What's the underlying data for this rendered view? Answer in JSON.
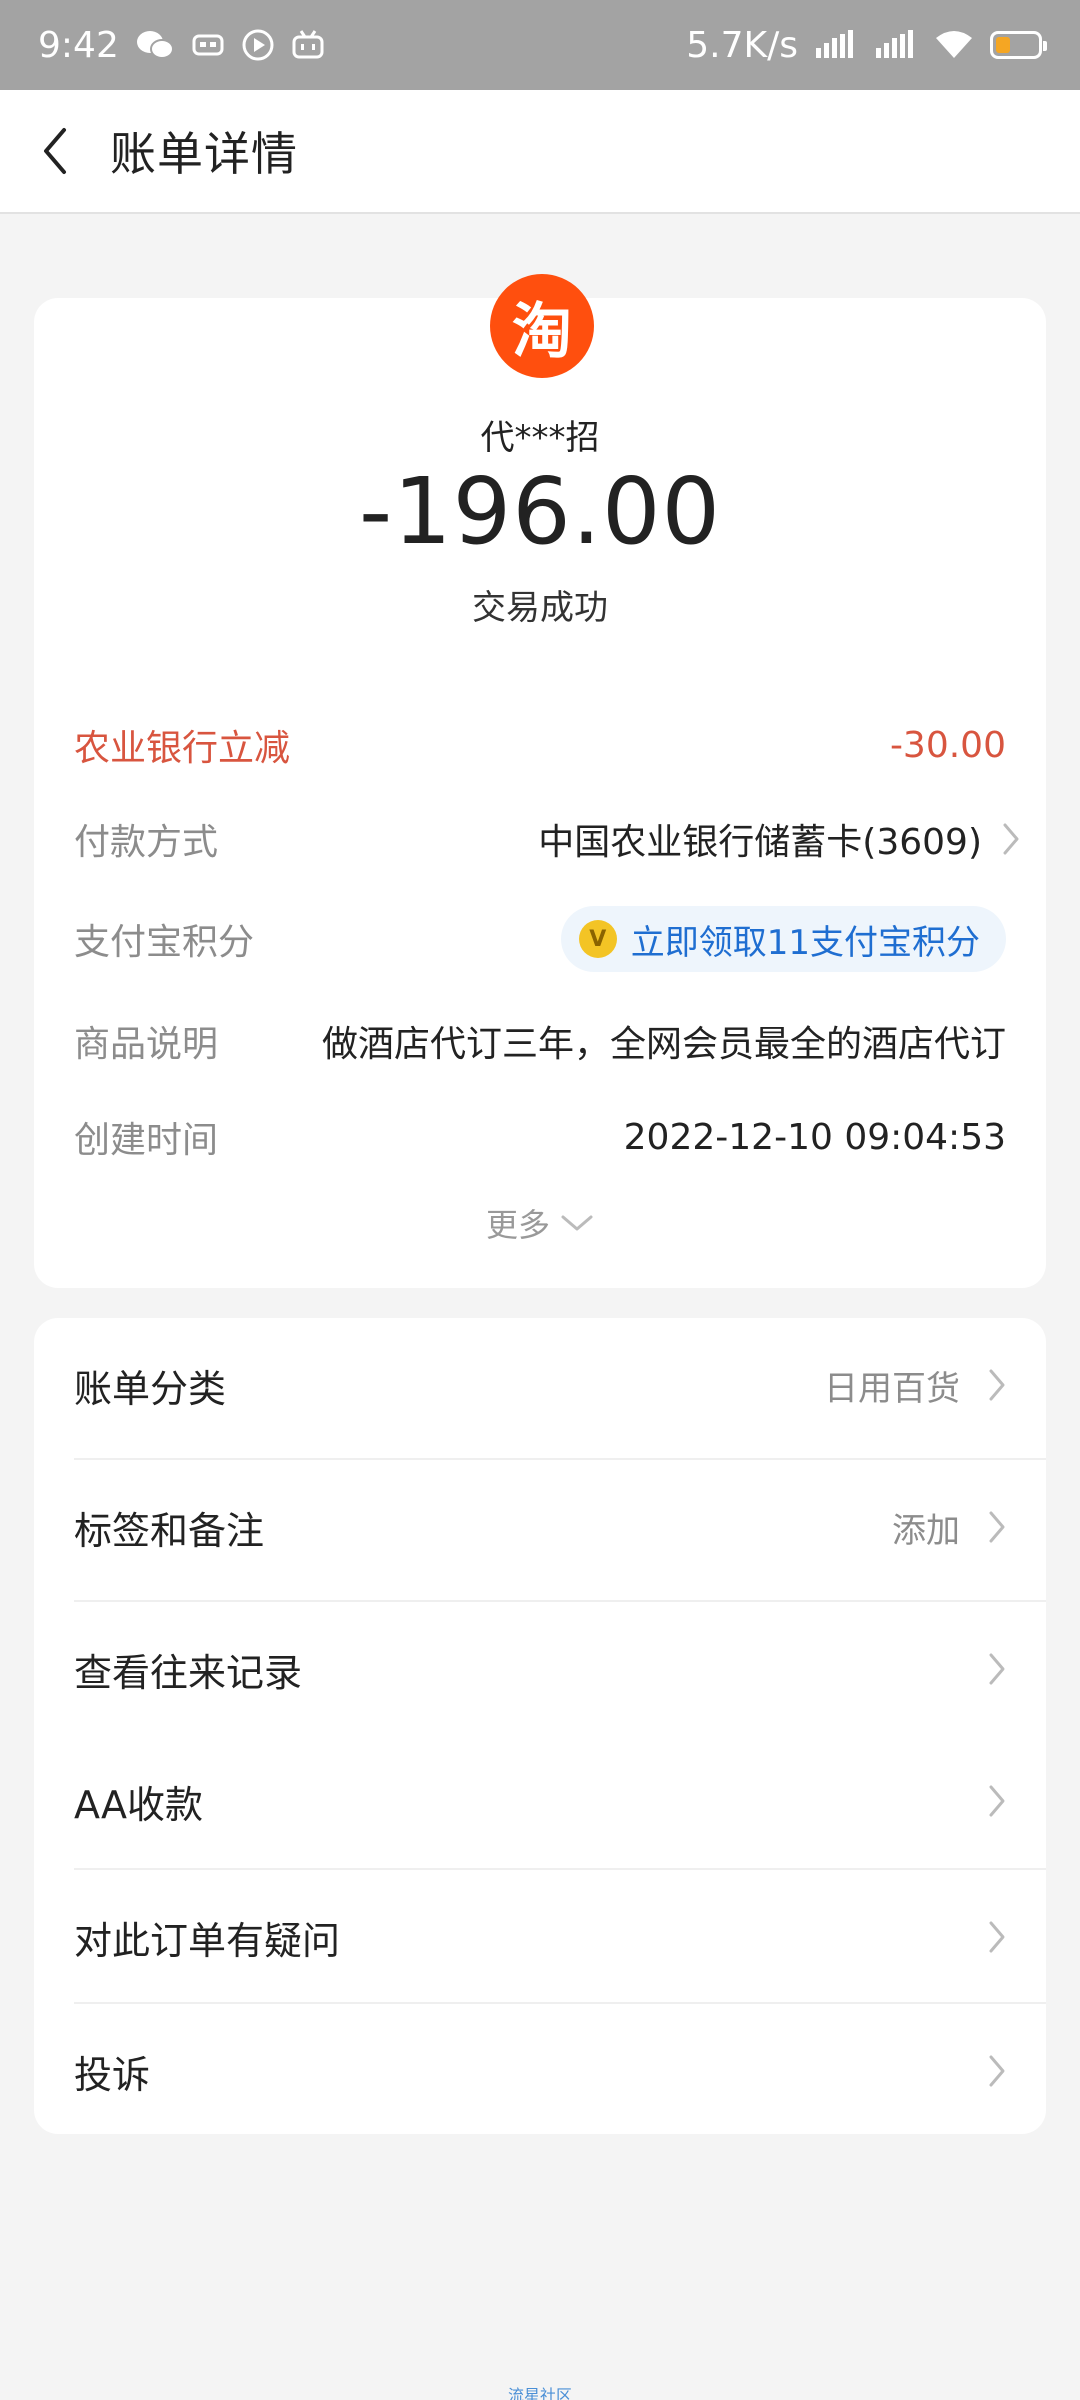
{
  "status_bar": {
    "time": "9:42",
    "net_speed": "5.7K/s",
    "battery_level": 0.35,
    "accent_battery": "#f5a623"
  },
  "header": {
    "title": "账单详情"
  },
  "merchant": {
    "logo_char": "淘",
    "name": "代***招",
    "amount": "-196.00",
    "status": "交易成功",
    "logo_color": "#ff4f0e"
  },
  "details": {
    "discount": {
      "label": "农业银行立减",
      "value": "-30.00"
    },
    "payment_method": {
      "label": "付款方式",
      "value": "中国农业银行储蓄卡(3609)"
    },
    "points": {
      "label": "支付宝积分",
      "value": "立即领取11支付宝积分",
      "coin_char": "V"
    },
    "description": {
      "label": "商品说明",
      "value": "做酒店代订三年，全网会员最全的酒店代订"
    },
    "created_time": {
      "label": "创建时间",
      "value": "2022-12-10 09:04:53"
    },
    "more_label": "更多"
  },
  "list": {
    "category": {
      "label": "账单分类",
      "value": "日用百货"
    },
    "tags": {
      "label": "标签和备注",
      "value": "添加"
    },
    "history": {
      "label": "查看往来记录"
    },
    "aa": {
      "label": "AA收款"
    },
    "question": {
      "label": "对此订单有疑问"
    },
    "complaint": {
      "label": "投诉"
    }
  },
  "footer": {
    "watermark": "流星社区"
  }
}
